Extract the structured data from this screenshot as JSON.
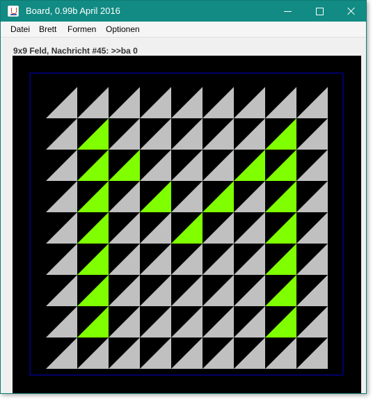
{
  "window": {
    "title": "Board, 0.99b April 2016",
    "icon": "java-cup-icon",
    "controls": [
      "minimize-icon",
      "maximize-icon",
      "close-icon"
    ],
    "titlebar_color": "#118b83"
  },
  "menubar": {
    "items": [
      "Datei",
      "Brett",
      "Formen",
      "Optionen"
    ]
  },
  "status": {
    "text": "9x9 Feld, Nachricht #45: >>ba 0"
  },
  "board": {
    "rows": 9,
    "cols": 9,
    "background_color": "#000000",
    "frame_color": "#0000cc",
    "cell_colors": {
      "off": "#c0c0c0",
      "on": "#80ff00"
    },
    "grid": [
      [
        0,
        0,
        0,
        0,
        0,
        0,
        0,
        0,
        0
      ],
      [
        0,
        1,
        0,
        0,
        0,
        0,
        0,
        1,
        0
      ],
      [
        0,
        1,
        1,
        0,
        0,
        0,
        1,
        1,
        0
      ],
      [
        0,
        1,
        0,
        1,
        0,
        1,
        0,
        1,
        0
      ],
      [
        0,
        1,
        0,
        0,
        1,
        0,
        0,
        1,
        0
      ],
      [
        0,
        1,
        0,
        0,
        0,
        0,
        0,
        1,
        0
      ],
      [
        0,
        1,
        0,
        0,
        0,
        0,
        0,
        1,
        0
      ],
      [
        0,
        1,
        0,
        0,
        0,
        0,
        0,
        1,
        0
      ],
      [
        0,
        0,
        0,
        0,
        0,
        0,
        0,
        0,
        0
      ]
    ]
  }
}
